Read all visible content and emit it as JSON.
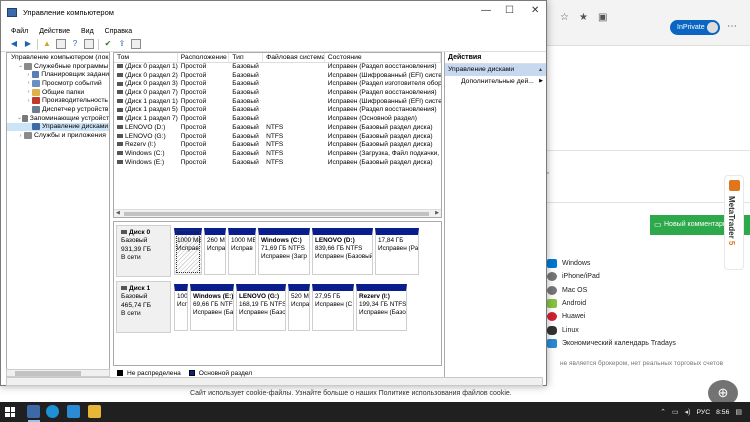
{
  "browser": {
    "inprivate_label": "InPrivate",
    "text_fragment": ",",
    "comment_button": "Новый комментарий",
    "platform_links": [
      {
        "icon": "windows-icon",
        "label": "Windows"
      },
      {
        "icon": "apple-icon",
        "label": "iPhone/iPad"
      },
      {
        "icon": "apple-icon",
        "label": "Mac OS"
      },
      {
        "icon": "android-icon",
        "label": "Android"
      },
      {
        "icon": "huawei-icon",
        "label": "Huawei"
      },
      {
        "icon": "linux-icon",
        "label": "Linux"
      },
      {
        "icon": "calendar-icon",
        "label": "Экономический календарь Tradays"
      }
    ],
    "disclaimer": "не является брокером, нет реальных торговых счетов",
    "metatrader_label": "MetaTrader",
    "metatrader_version": "5",
    "cookie_text": "Сайт использует cookie-файлы. Узнайте больше о наших Политике использования файлов cookie."
  },
  "window": {
    "title": "Управление компьютером",
    "controls": {
      "minimize": "—",
      "maximize": "☐",
      "close": "✕"
    }
  },
  "menu": [
    "Файл",
    "Действие",
    "Вид",
    "Справка"
  ],
  "tree": [
    {
      "label": "Управление компьютером (локал",
      "ex": "",
      "level": 0,
      "color": "#3c6aa8"
    },
    {
      "label": "Служебные программы",
      "ex": "⌄",
      "level": 1,
      "color": "#8a8a8a"
    },
    {
      "label": "Планировщик задани",
      "ex": "›",
      "level": 2,
      "color": "#5a7fb5"
    },
    {
      "label": "Просмотр событий",
      "ex": "›",
      "level": 2,
      "color": "#6a8fc0"
    },
    {
      "label": "Общие папки",
      "ex": "›",
      "level": 2,
      "color": "#e0b14a"
    },
    {
      "label": "Производительность",
      "ex": "›",
      "level": 2,
      "color": "#c0392b"
    },
    {
      "label": "Диспетчер устройств",
      "ex": "",
      "level": 2,
      "color": "#6b7d91"
    },
    {
      "label": "Запоминающие устройст",
      "ex": "⌄",
      "level": 1,
      "color": "#7a7a7a"
    },
    {
      "label": "Управление дисками",
      "ex": "",
      "level": 2,
      "color": "#3c6aa8",
      "selected": true
    },
    {
      "label": "Службы и приложения",
      "ex": "›",
      "level": 1,
      "color": "#8a8a8a"
    }
  ],
  "volume_table": {
    "columns": [
      "Том",
      "Расположение",
      "Тип",
      "Файловая система",
      "Состояние"
    ],
    "rows": [
      [
        "(Диск 0 раздел 1)",
        "Простой",
        "Базовый",
        "",
        "Исправен (Раздел восстановления)"
      ],
      [
        "(Диск 0 раздел 2)",
        "Простой",
        "Базовый",
        "",
        "Исправен (Шифрованный (EFI) систе"
      ],
      [
        "(Диск 0 раздел 3)",
        "Простой",
        "Базовый",
        "",
        "Исправен (Раздел изготовителя обор"
      ],
      [
        "(Диск 0 раздел 7)",
        "Простой",
        "Базовый",
        "",
        "Исправен (Раздел восстановления)"
      ],
      [
        "(Диск 1 раздел 1)",
        "Простой",
        "Базовый",
        "",
        "Исправен (Шифрованный (EFI) систе"
      ],
      [
        "(Диск 1 раздел 5)",
        "Простой",
        "Базовый",
        "",
        "Исправен (Раздел восстановления)"
      ],
      [
        "(Диск 1 раздел 7)",
        "Простой",
        "Базовый",
        "",
        "Исправен (Основной раздел)"
      ],
      [
        "LENOVO (D:)",
        "Простой",
        "Базовый",
        "NTFS",
        "Исправен (Базовый раздел диска)"
      ],
      [
        "LENOVO (G:)",
        "Простой",
        "Базовый",
        "NTFS",
        "Исправен (Базовый раздел диска)"
      ],
      [
        "Rezerv (I:)",
        "Простой",
        "Базовый",
        "NTFS",
        "Исправен (Базовый раздел диска)"
      ],
      [
        "Windows (C:)",
        "Простой",
        "Базовый",
        "NTFS",
        "Исправен (Загрузка, Файл подкачки,"
      ],
      [
        "Windows (E:)",
        "Простой",
        "Базовый",
        "NTFS",
        "Исправен (Базовый раздел диска)"
      ]
    ]
  },
  "disks": [
    {
      "name": "Диск 0",
      "type": "Базовый",
      "size": "931,39 ГБ",
      "status": "В сети",
      "partitions": [
        {
          "name": "",
          "size": "1000 МБ",
          "state": "Исправ",
          "hatched": true
        },
        {
          "name": "",
          "size": "260 МІ",
          "state": "Испра"
        },
        {
          "name": "",
          "size": "1000 МБ",
          "state": "Исправ"
        },
        {
          "name": "Windows (C:)",
          "size": "71,69 ГБ NTFS",
          "state": "Исправен (Загр"
        },
        {
          "name": "LENOVO (D:)",
          "size": "839,66 ГБ NTFS",
          "state": "Исправен (Базовый"
        },
        {
          "name": "",
          "size": "17,84 ГБ",
          "state": "Исправен (Ра"
        }
      ]
    },
    {
      "name": "Диск 1",
      "type": "Базовый",
      "size": "465,74 ГБ",
      "status": "В сети",
      "partitions": [
        {
          "name": "",
          "size": "100",
          "state": "Испр"
        },
        {
          "name": "Windows (E:)",
          "size": "69,66 ГБ NTFS",
          "state": "Исправен (Баз"
        },
        {
          "name": "LENOVO (G:)",
          "size": "168,19 ГБ NTFS",
          "state": "Исправен (Базо"
        },
        {
          "name": "",
          "size": "520 МІ",
          "state": "Испра"
        },
        {
          "name": "",
          "size": "27,95 ГБ",
          "state": "Исправен (С"
        },
        {
          "name": "Rezerv (I:)",
          "size": "199,34 ГБ NTFS",
          "state": "Исправен (Базов"
        }
      ]
    }
  ],
  "legend": [
    {
      "label": "Не распределена",
      "color": "#000000"
    },
    {
      "label": "Основной раздел",
      "color": "#0a1d8c"
    }
  ],
  "actions": {
    "header": "Действия",
    "section": "Управление дисками",
    "item": "Дополнительные дей..."
  },
  "taskbar": {
    "language": "РУС",
    "time": "8:56"
  }
}
